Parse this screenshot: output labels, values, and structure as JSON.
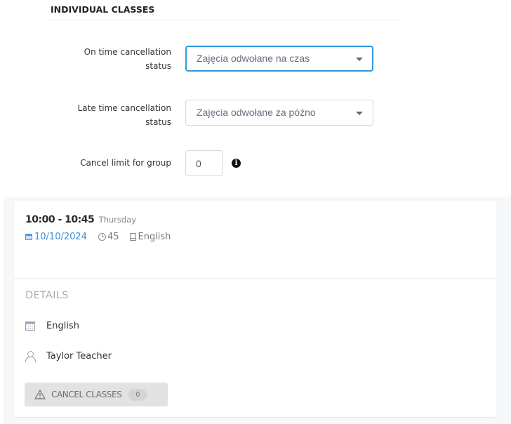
{
  "section": {
    "title": "INDIVIDUAL CLASSES"
  },
  "form": {
    "on_time": {
      "label_line1": "On time cancellation",
      "label_line2": "status",
      "value": "Zajęcia odwołane na czas"
    },
    "late_time": {
      "label_line1": "Late time cancellation",
      "label_line2": "status",
      "value": "Zajęcia odwołane za późno"
    },
    "cancel_limit": {
      "label": "Cancel limit for group",
      "value": "0",
      "info_icon": "i"
    }
  },
  "class_card": {
    "time_range": "10:00 - 10:45",
    "weekday": "Thursday",
    "date": "10/10/2024",
    "duration": "45",
    "subject": "English",
    "details": {
      "title": "DETAILS",
      "subject": "English",
      "teacher": "Taylor Teacher"
    },
    "cancel_button": {
      "label": "CANCEL CLASSES",
      "count": "0"
    }
  },
  "colors": {
    "accent_blue": "#2d9cdb",
    "date_blue": "#3a8fd8",
    "details_gray": "#a6adb8"
  }
}
